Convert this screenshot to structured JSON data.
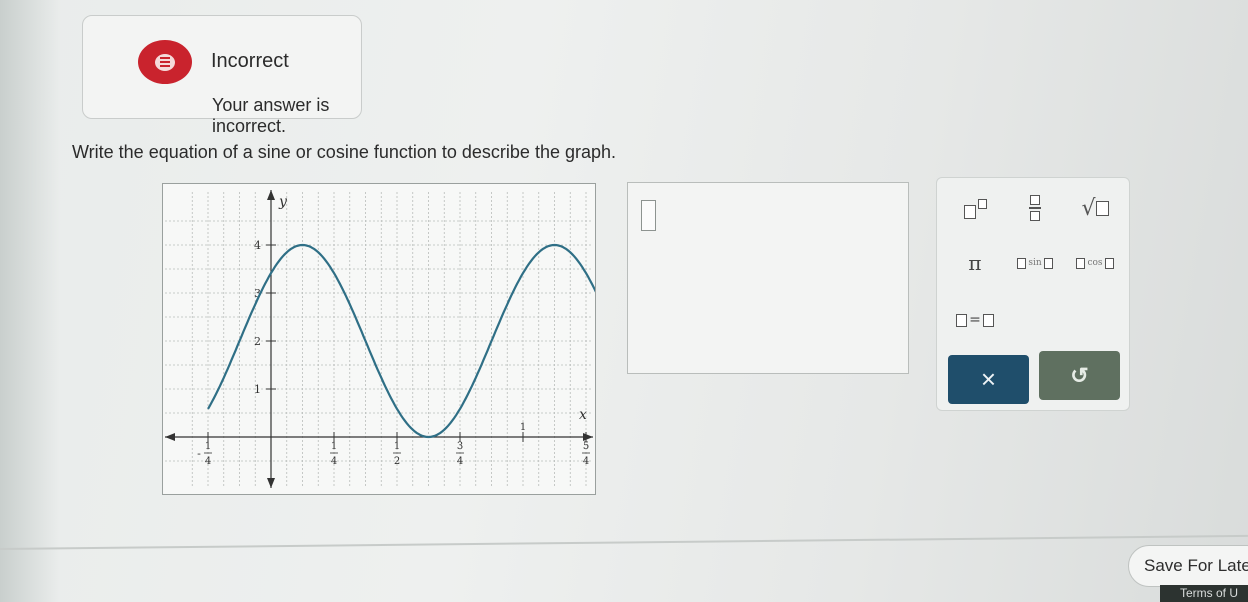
{
  "feedback": {
    "title": "Incorrect",
    "message": "Your answer is incorrect.",
    "icon": "feedback-icon",
    "color": "#c9232d"
  },
  "question": {
    "prompt": "Write the equation of a sine or cosine function to describe the graph."
  },
  "graph": {
    "y_label": "y",
    "x_label": "x",
    "y_ticks": [
      "1",
      "2",
      "3",
      "4"
    ],
    "x_ticks": [
      {
        "sign": "-",
        "num": "1",
        "den": "4"
      },
      {
        "sign": "",
        "num": "1",
        "den": "4"
      },
      {
        "sign": "",
        "num": "1",
        "den": "2"
      },
      {
        "sign": "",
        "num": "3",
        "den": "4"
      },
      {
        "sign": "",
        "num": "1",
        "den": ""
      },
      {
        "sign": "",
        "num": "5",
        "den": "4"
      }
    ]
  },
  "chart_data": {
    "type": "line",
    "title": "",
    "xlabel": "x",
    "ylabel": "y",
    "xlim": [
      -0.3125,
      1.4
    ],
    "ylim": [
      -0.6,
      4.6
    ],
    "grid": true,
    "function": "y = 2cos(2π(x - 0.125)) + 2",
    "series": [
      {
        "x": [
          -0.25,
          -0.125,
          0,
          0.125,
          0.25,
          0.375,
          0.5,
          0.625,
          0.75,
          0.875,
          1,
          1.125,
          1.25,
          1.3125
        ],
        "values": [
          0.6,
          2,
          3.41,
          4,
          3.41,
          2,
          0.59,
          0,
          0.59,
          2,
          3.41,
          4,
          3.41,
          2.77
        ]
      }
    ]
  },
  "answer": {
    "value": ""
  },
  "palette": {
    "pi": "π",
    "sin": "sin",
    "cos": "cos",
    "equals": "=",
    "clear": "×",
    "undo": "↺"
  },
  "footer": {
    "save_label": "Save For Late",
    "terms": "Terms of U"
  }
}
